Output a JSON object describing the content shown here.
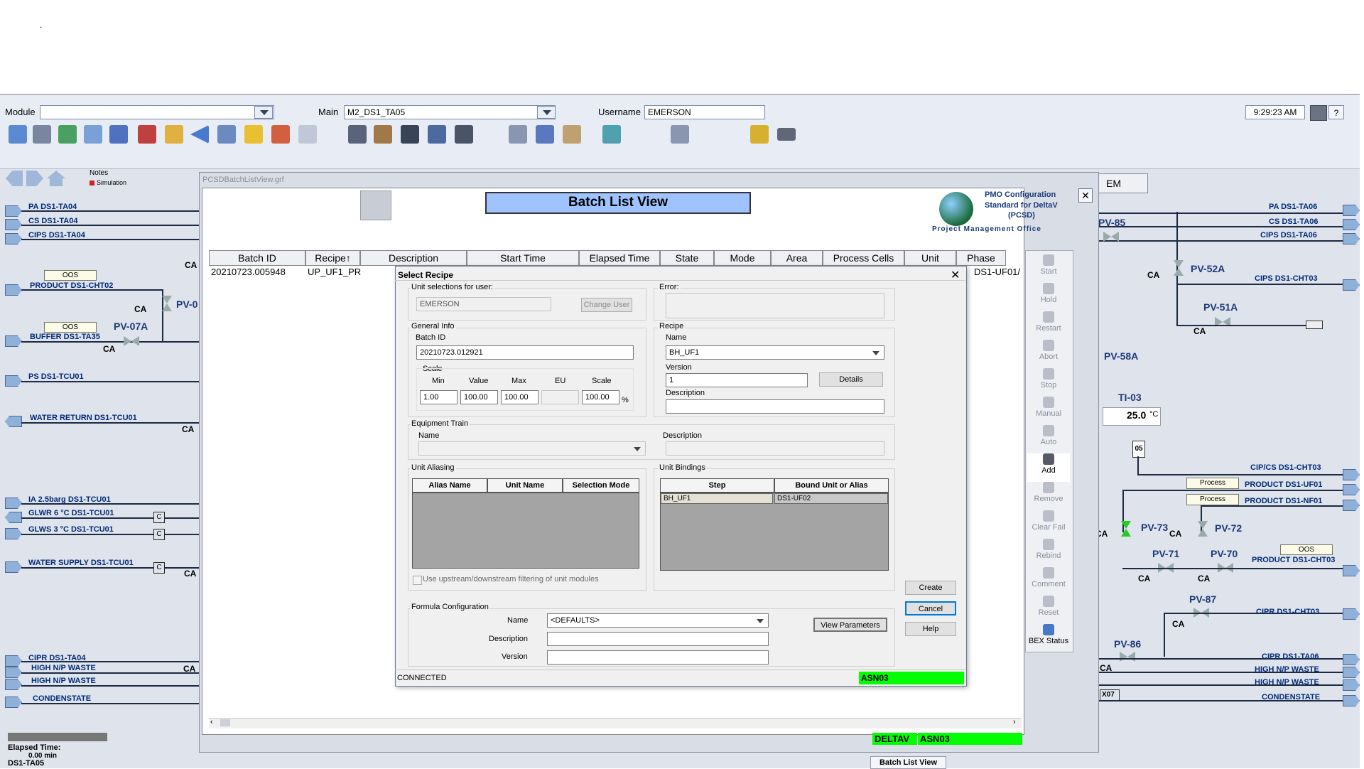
{
  "top_dot": ".",
  "header": {
    "module_label": "Module",
    "module_value": "",
    "main_label": "Main",
    "main_value": "M2_DS1_TA05",
    "username_label": "Username",
    "username_value": "EMERSON",
    "time": "9:29:23 AM",
    "help": "?"
  },
  "notes": {
    "label": "Notes",
    "simulation": "Simulation"
  },
  "left_lines": {
    "pa": "PA DS1-TA04",
    "cs": "CS DS1-TA04",
    "cips": "CIPS DS1-TA04",
    "oos1": "OOS",
    "product": "PRODUCT DS1-CHT02",
    "pv0": "PV-0",
    "ca1": "CA",
    "ca2": "CA",
    "oos2": "OOS",
    "pv07a": "PV-07A",
    "buffer": "BUFFER DS1-TA35",
    "ca3": "CA",
    "ps": "PS DS1-TCU01",
    "water_return": "WATER RETURN DS1-TCU01",
    "ca4": "CA",
    "ia": "IA 2.5barg DS1-TCU01",
    "glwr": "GLWR 6 °C DS1-TCU01",
    "glws": "GLWS 3 °C  DS1-TCU01",
    "water_supply": "WATER SUPPLY DS1-TCU01",
    "ca5": "CA",
    "cipr": "CIPR DS1-TA04",
    "high1": "HIGH N/P WASTE",
    "ca6": "CA",
    "high2": "HIGH N/P WASTE",
    "condensate": "CONDENSTATE",
    "c1": "C",
    "c2": "C",
    "c3": "C"
  },
  "left_footer": {
    "elapsed_label": "Elapsed Time:",
    "elapsed_value": "0.00 min",
    "unit": "DS1-TA05"
  },
  "right_lines": {
    "em": "EM",
    "pa": "PA DS1-TA06",
    "cs": "CS DS1-TA06",
    "cips": "CIPS DS1-TA06",
    "pv85": "PV-85",
    "pv52a": "PV-52A",
    "ca1": "CA",
    "cips_cht03": "CIPS DS1-CHT03",
    "pv51a": "PV-51A",
    "ca2": "CA",
    "pv58a": "PV-58A",
    "ti03": "TI-03",
    "ti03_value": "25.0",
    "ti03_unit": "°C",
    "box05": "05",
    "cipcs": "CIP/CS DS1-CHT03",
    "process1": "Process",
    "product_uf01": "PRODUCT DS1-UF01",
    "process2": "Process",
    "product_nf01": "PRODUCT DS1-NF01",
    "ca3": "CA",
    "pv73": "PV-73",
    "ca4": "CA",
    "pv72": "PV-72",
    "oos": "OOS",
    "pv71": "PV-71",
    "pv70": "PV-70",
    "product_cht03": "PRODUCT DS1-CHT03",
    "ca5": "CA",
    "ca6": "CA",
    "pv87": "PV-87",
    "cipr_cht03": "CIPR DS1-CHT03",
    "ca7": "CA",
    "pv86": "PV-86",
    "cipr_ta06": "CIPR DS1-TA06",
    "ca8": "CA",
    "high1": "HIGH N/P WASTE",
    "high2": "HIGH N/P WASTE",
    "x07": "X07",
    "condensate": "CONDENSTATE"
  },
  "batch_list": {
    "file": "PCSDBatchListView.grf",
    "title": "Batch List View",
    "pmo_line1": "PMO Configuration",
    "pmo_line2": "Standard for DeltaV",
    "pmo_line3": "(PCSD)",
    "pmo_office": "Project Management Office",
    "columns": [
      "Batch ID",
      "Recipe↑",
      "Description",
      "Start Time",
      "Elapsed Time",
      "State",
      "Mode",
      "Area",
      "Process Cells",
      "Unit",
      "Phase"
    ],
    "row": {
      "batch_id": "20210723.005948",
      "recipe": "UP_UF1_PR",
      "phase": "DS1-UF01/"
    },
    "side_buttons": [
      "Start",
      "Hold",
      "Restart",
      "Abort",
      "Stop",
      "Manual",
      "Auto",
      "Add",
      "Remove",
      "Clear Fail",
      "Rebind",
      "Comment",
      "Reset",
      "BEX Status"
    ],
    "status_deltav": "DELTAV",
    "status_node": "ASN03",
    "taskbar_tab": "Batch List View"
  },
  "dialog": {
    "title": "Select Recipe",
    "unit_sel_label": "Unit selections for user:",
    "user_value": "EMERSON",
    "change_user": "Change User",
    "error_label": "Error:",
    "general_info": "General Info",
    "batch_id_label": "Batch ID",
    "batch_id_value": "20210723.012921",
    "scale_label": "Scale",
    "scale_headers": [
      "Min",
      "Value",
      "Max",
      "EU",
      "Scale"
    ],
    "scale_values": [
      "1.00",
      "100.00",
      "100.00",
      "",
      "100.00"
    ],
    "percent": "%",
    "recipe_label": "Recipe",
    "name_label": "Name",
    "recipe_name": "BH_UF1",
    "version_label": "Version",
    "version_value": "1",
    "details": "Details",
    "description_label": "Description",
    "equip_train": "Equipment Train",
    "et_name_label": "Name",
    "et_desc_label": "Description",
    "unit_aliasing": "Unit Aliasing",
    "alias_cols": [
      "Alias Name",
      "Unit Name",
      "Selection Mode"
    ],
    "unit_bindings": "Unit Bindings",
    "binding_cols": [
      "Step",
      "Bound Unit or Alias"
    ],
    "binding_row": [
      "BH_UF1",
      "DS1-UF02"
    ],
    "upstream_check": "Use upstream/downstream filtering of unit modules",
    "create": "Create",
    "cancel": "Cancel",
    "help": "Help",
    "formula_config": "Formula Configuration",
    "f_name_label": "Name",
    "f_name_value": "<DEFAULTS>",
    "f_desc_label": "Description",
    "f_version_label": "Version",
    "view_params": "View Parameters",
    "status": "CONNECTED",
    "node": "ASN03"
  },
  "colors": {
    "green": "#00ff00",
    "title_blue": "#9ec3ff",
    "pipe_label": "#002b7a"
  }
}
